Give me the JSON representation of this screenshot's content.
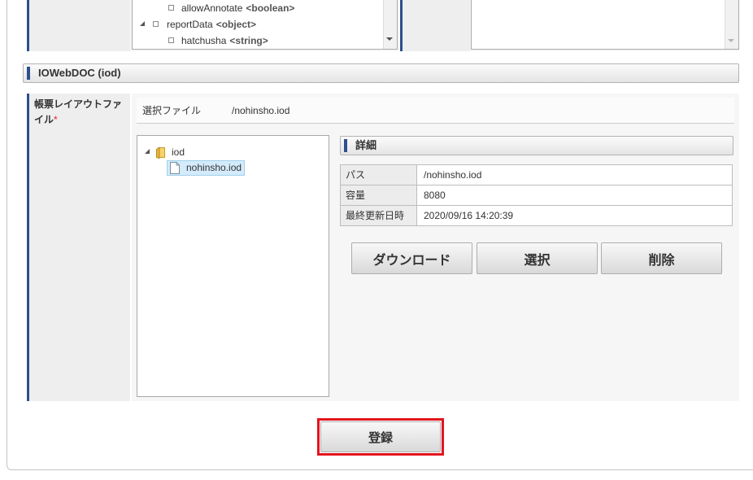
{
  "colors": {
    "accent": "#2d4f8e",
    "required": "#e02020",
    "highlight_outline": "#e3141e",
    "selection": "#d3ebfb"
  },
  "top_tree": {
    "items": [
      {
        "label": "allowAnnotate",
        "type": "<boolean>",
        "icon": "node-square-icon"
      },
      {
        "label": "reportData",
        "type": "<object>",
        "icon": "node-square-icon",
        "expander_icon": "expanded-triangle-icon"
      },
      {
        "label": "hatchusha",
        "type": "<string>",
        "icon": "node-square-icon"
      }
    ]
  },
  "section": {
    "title": "IOWebDOC (iod)"
  },
  "field": {
    "label": "帳票レイアウトファイル",
    "required_mark": "*"
  },
  "selected_file": {
    "label": "選択ファイル",
    "value": "/nohinsho.iod"
  },
  "file_tree": {
    "folder": {
      "label": "iod",
      "icon": "folder-icon",
      "expander_icon": "expanded-triangle-icon"
    },
    "file": {
      "label": "nohinsho.iod",
      "icon": "file-icon",
      "selected": true
    }
  },
  "details": {
    "title": "詳細",
    "rows": [
      {
        "label": "パス",
        "value": "/nohinsho.iod"
      },
      {
        "label": "容量",
        "value": "8080"
      },
      {
        "label": "最終更新日時",
        "value": "2020/09/16 14:20:39"
      }
    ]
  },
  "actions": {
    "download": "ダウンロード",
    "select": "選択",
    "delete": "削除"
  },
  "register": {
    "label": "登録"
  }
}
